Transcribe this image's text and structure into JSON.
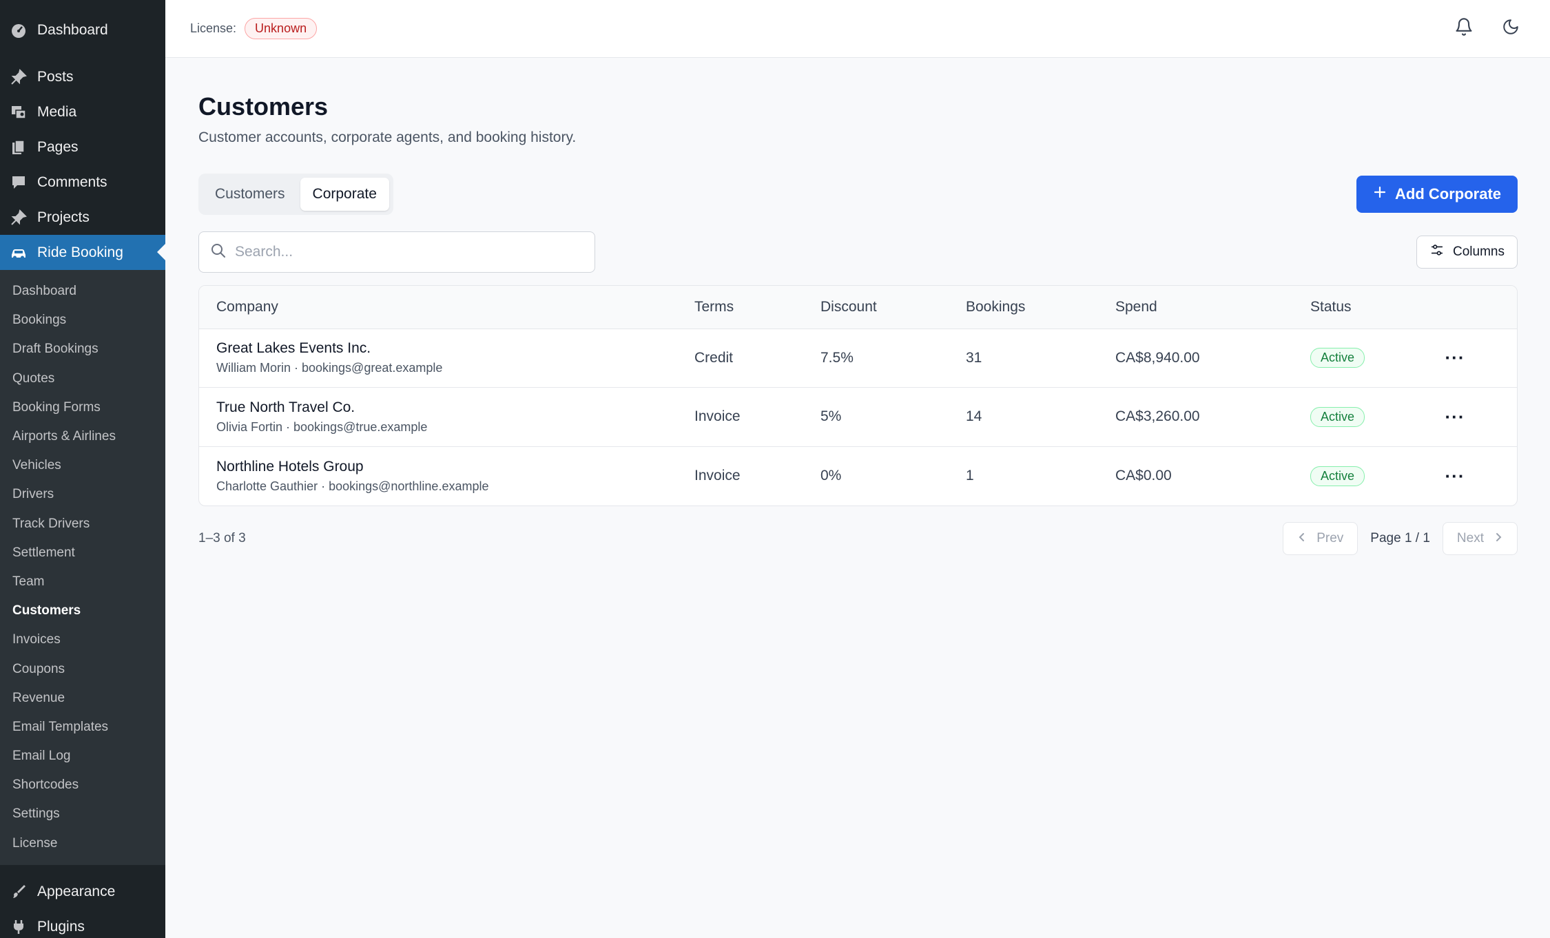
{
  "sidebar": {
    "top": [
      {
        "label": "Dashboard",
        "icon": "gauge-icon"
      },
      {
        "label": "Posts",
        "icon": "pin-icon"
      },
      {
        "label": "Media",
        "icon": "media-icon"
      },
      {
        "label": "Pages",
        "icon": "pages-icon"
      },
      {
        "label": "Comments",
        "icon": "comment-icon"
      },
      {
        "label": "Projects",
        "icon": "pin-icon"
      },
      {
        "label": "Ride Booking",
        "icon": "car-icon"
      }
    ],
    "submenu": [
      "Dashboard",
      "Bookings",
      "Draft Bookings",
      "Quotes",
      "Booking Forms",
      "Airports & Airlines",
      "Vehicles",
      "Drivers",
      "Track Drivers",
      "Settlement",
      "Team",
      "Customers",
      "Invoices",
      "Coupons",
      "Revenue",
      "Email Templates",
      "Email Log",
      "Shortcodes",
      "Settings",
      "License"
    ],
    "bottom": [
      {
        "label": "Appearance",
        "icon": "brush-icon"
      },
      {
        "label": "Plugins",
        "icon": "plug-icon"
      }
    ]
  },
  "header": {
    "license_label": "License:",
    "license_status": "Unknown"
  },
  "page": {
    "title": "Customers",
    "subtitle": "Customer accounts, corporate agents, and booking history.",
    "tabs": [
      "Customers",
      "Corporate"
    ],
    "active_tab": "Corporate",
    "add_button": "Add Corporate",
    "search_placeholder": "Search...",
    "columns_button": "Columns"
  },
  "table": {
    "headers": [
      "Company",
      "Terms",
      "Discount",
      "Bookings",
      "Spend",
      "Status"
    ],
    "rows": [
      {
        "company": "Great Lakes Events Inc.",
        "meta": "William Morin · bookings@great.example",
        "terms": "Credit",
        "discount": "7.5%",
        "bookings": "31",
        "spend": "CA$8,940.00",
        "status": "Active"
      },
      {
        "company": "True North Travel Co.",
        "meta": "Olivia Fortin · bookings@true.example",
        "terms": "Invoice",
        "discount": "5%",
        "bookings": "14",
        "spend": "CA$3,260.00",
        "status": "Active"
      },
      {
        "company": "Northline Hotels Group",
        "meta": "Charlotte Gauthier · bookings@northline.example",
        "terms": "Invoice",
        "discount": "0%",
        "bookings": "1",
        "spend": "CA$0.00",
        "status": "Active"
      }
    ]
  },
  "pagination": {
    "range": "1–3 of 3",
    "prev": "Prev",
    "page": "Page 1 / 1",
    "next": "Next"
  },
  "colors": {
    "sidebar_bg": "#1d2327",
    "accent": "#2563eb",
    "active_status": "#15803d",
    "license_badge": "#b91c1c"
  }
}
